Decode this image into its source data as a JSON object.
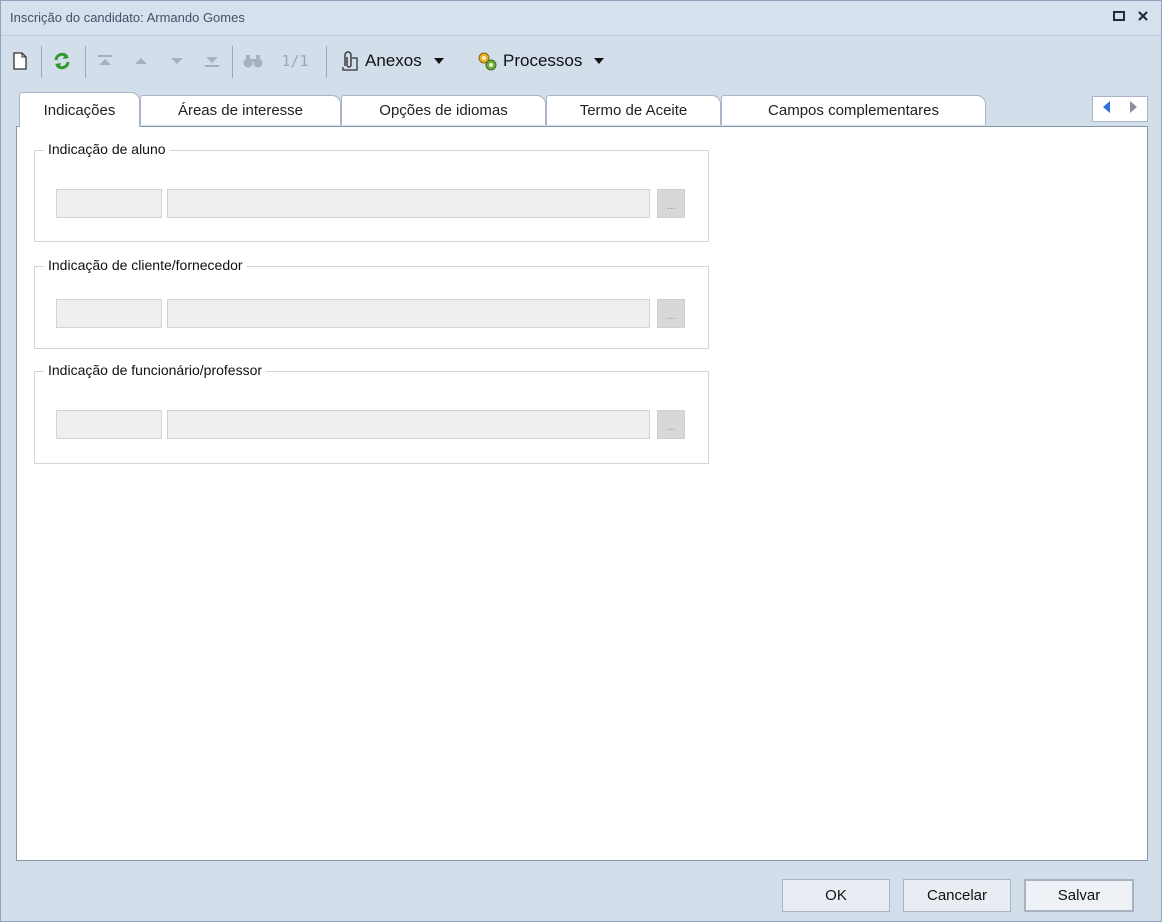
{
  "window": {
    "title": "Inscrição do candidato: Armando Gomes",
    "restore_glyph": "▫",
    "close_glyph": "✕"
  },
  "toolbar": {
    "record_counter": "1/1",
    "attachments_label": "Anexos",
    "processes_label": "Processos",
    "icons": [
      "new-document-icon",
      "refresh-icon",
      "first-record-icon",
      "previous-record-icon",
      "next-record-icon",
      "last-record-icon",
      "find-icon",
      "paperclip-icon",
      "processes-gear-icon"
    ]
  },
  "tabs": [
    {
      "label": "Indicações",
      "active": true
    },
    {
      "label": "Áreas de interesse",
      "active": false
    },
    {
      "label": "Opções de idiomas",
      "active": false
    },
    {
      "label": "Termo de Aceite",
      "active": false
    },
    {
      "label": "Campos complementares",
      "active": false
    }
  ],
  "groups": [
    {
      "title": "Indicação de aluno",
      "code_value": "",
      "name_value": "",
      "lookup_label": "..."
    },
    {
      "title": "Indicação de cliente/fornecedor",
      "code_value": "",
      "name_value": "",
      "lookup_label": "..."
    },
    {
      "title": "Indicação de funcionário/professor",
      "code_value": "",
      "name_value": "",
      "lookup_label": "..."
    }
  ],
  "footer": {
    "ok_label": "OK",
    "cancel_label": "Cancelar",
    "save_label": "Salvar"
  },
  "colors": {
    "frame": "#d3deeb",
    "title_text": "#41526b",
    "accent_blue": "#2f6fd6",
    "refresh_green": "#2f9a2f"
  }
}
